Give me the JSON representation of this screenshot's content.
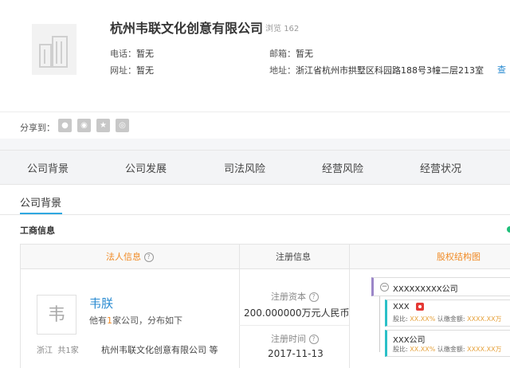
{
  "company": {
    "name": "杭州韦联文化创意有限公司",
    "views_label": "浏览",
    "views": "162",
    "phone_label": "电话：",
    "phone": "暂无",
    "email_label": "邮箱：",
    "email": "暂无",
    "website_label": "网址：",
    "website": "暂无",
    "address_label": "地址：",
    "address": "浙江省杭州市拱墅区科园路188号3幢二层213室",
    "address_link": "查"
  },
  "share": {
    "label": "分享到：",
    "buttons": [
      "qq-space-icon",
      "weibo-icon",
      "star-icon",
      "wechat-icon"
    ]
  },
  "tabs": [
    "公司背景",
    "公司发展",
    "司法风险",
    "经营风险",
    "经营状况"
  ],
  "section": {
    "title": "公司背景",
    "subtitle": "工商信息"
  },
  "table": {
    "col_legal": "法人信息",
    "col_reg": "注册信息",
    "col_equity": "股权结构图"
  },
  "legal": {
    "avatar_char": "韦",
    "name": "韦朕",
    "sub_prefix": "他有",
    "sub_count": "1",
    "sub_suffix": "家公司，分布如下",
    "region": "浙江",
    "region_count": "共1家",
    "company": "杭州韦联文化创意有限公司 等"
  },
  "registration": {
    "capital_label": "注册资本",
    "capital": "200.000000万元人民币",
    "date_label": "注册时间",
    "date": "2017-11-13"
  },
  "equity": {
    "root": "XXXXXXXXX公司",
    "holders": [
      {
        "name": "XXX",
        "share_label": "股比:",
        "share": "XX.XX%",
        "paid_label": "认缴金额:",
        "paid": "XXXX.XX万"
      },
      {
        "name": "XXX公司",
        "share_label": "股比:",
        "share": "XX.XX%",
        "paid_label": "认缴金额:",
        "paid": "XXXX.XX万"
      }
    ]
  },
  "colors": {
    "accent_blue": "#2fa8e0",
    "orange": "#f08a24",
    "link_blue": "#2a8bd1"
  }
}
